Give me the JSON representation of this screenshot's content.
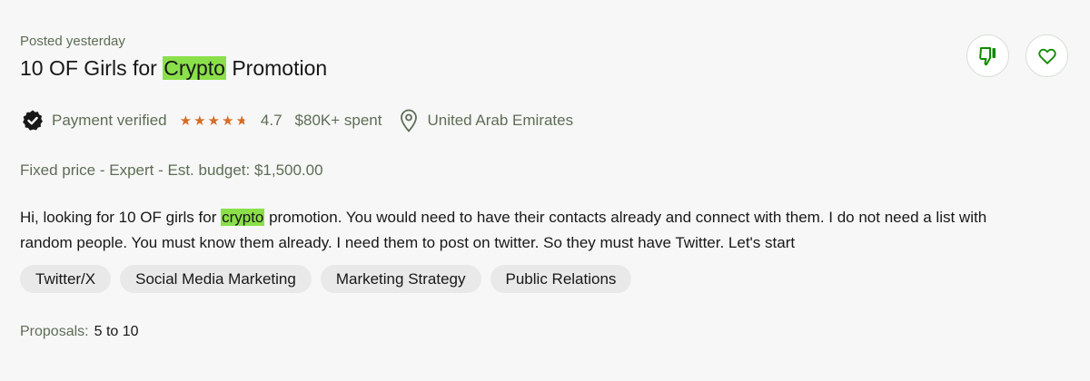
{
  "job": {
    "posted": "Posted yesterday",
    "title_before": "10 OF Girls for ",
    "title_highlight": "Crypto",
    "title_after": " Promotion",
    "client": {
      "payment_status": "Payment verified",
      "rating": "4.7",
      "rating_fraction": 0.94,
      "spent": "$80K+ spent",
      "location": "United Arab Emirates"
    },
    "budget_line": "Fixed price - Expert - Est. budget: $1,500.00",
    "description_before": "Hi, looking for 10 OF girls for ",
    "description_highlight": "crypto",
    "description_after": " promotion. You would need to have their contacts already and connect with them. I do not need a list with random people. You must know them already. I need them to post on twitter. So they must have Twitter. Let's start",
    "tags": [
      "Twitter/X",
      "Social Media Marketing",
      "Marketing Strategy",
      "Public Relations"
    ],
    "proposals_label": "Proposals:",
    "proposals_value": "5 to 10"
  },
  "icons": {
    "dislike": "thumbs-down-icon",
    "save": "heart-icon",
    "verified": "verified-badge-icon",
    "location": "location-pin-icon"
  },
  "colors": {
    "highlight": "#8be04a",
    "star": "#d46d26",
    "brand_green": "#108a00",
    "muted_text": "#5e6d55",
    "tag_bg": "#e9e9e9"
  }
}
